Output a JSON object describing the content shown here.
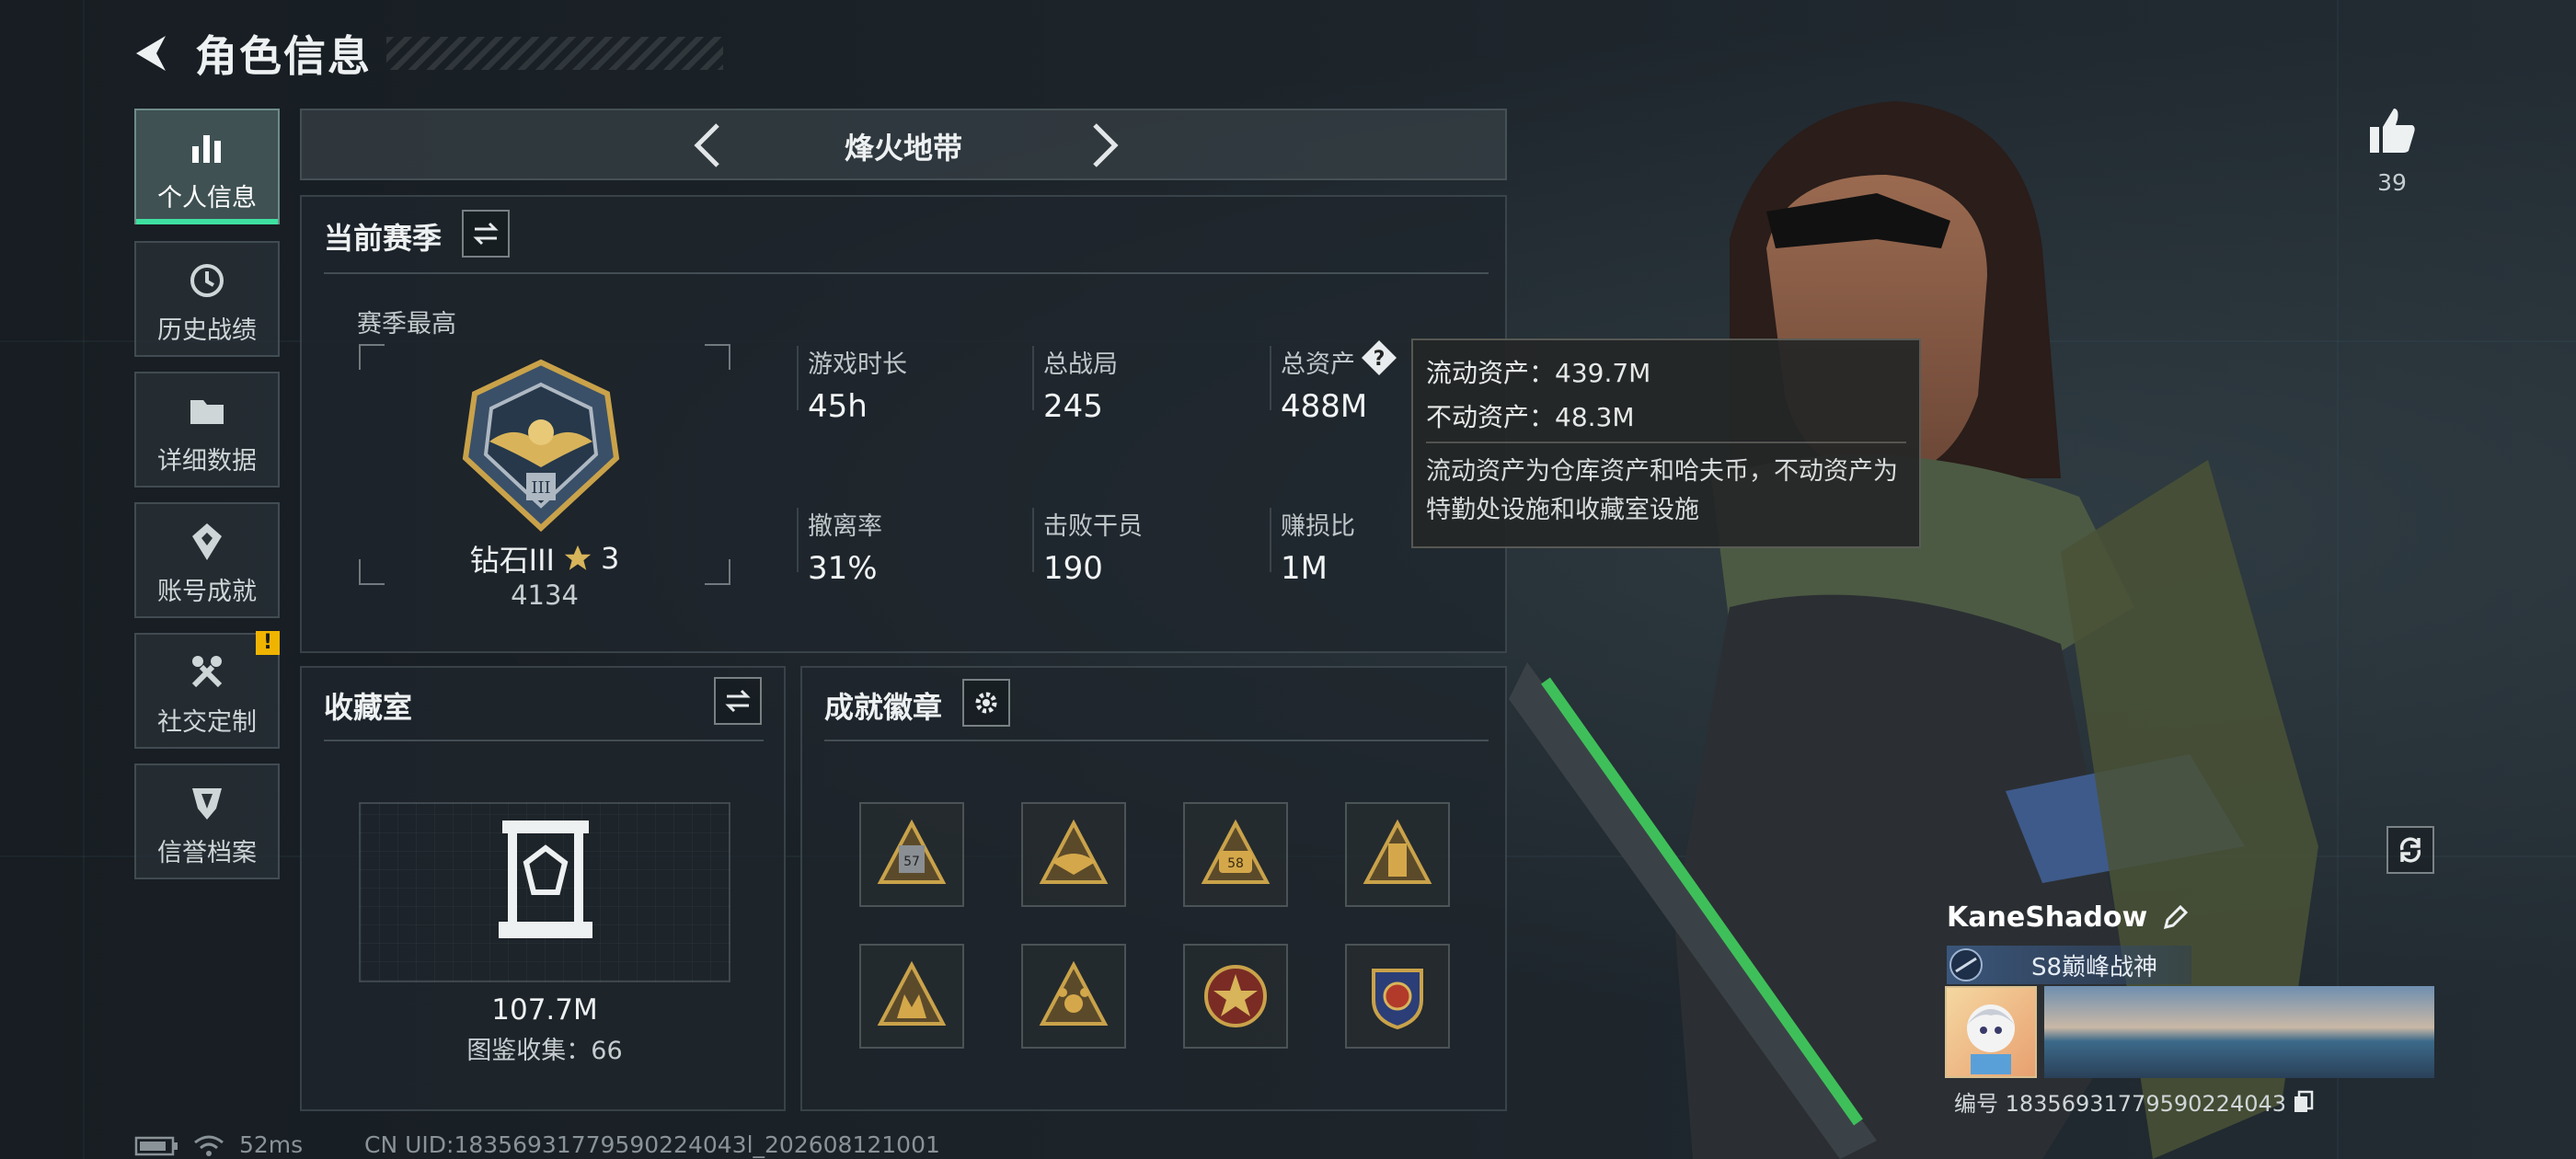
{
  "header": {
    "title": "角色信息"
  },
  "sidebar": {
    "items": [
      {
        "label": "个人信息",
        "icon": "bar-chart-icon"
      },
      {
        "label": "历史战绩",
        "icon": "history-icon"
      },
      {
        "label": "详细数据",
        "icon": "folder-icon"
      },
      {
        "label": "账号成就",
        "icon": "achievement-icon"
      },
      {
        "label": "社交定制",
        "icon": "tools-icon"
      },
      {
        "label": "信誉档案",
        "icon": "shield-icon"
      }
    ],
    "alert_badge": "!"
  },
  "mode_selector": {
    "label": "烽火地带"
  },
  "season": {
    "title": "当前赛季",
    "best_label": "赛季最高",
    "rank_name": "钻石III",
    "rank_stars": "3",
    "rank_points": "4134",
    "stats": [
      {
        "label": "游戏时长",
        "value": "45h"
      },
      {
        "label": "总战局",
        "value": "245"
      },
      {
        "label": "总资产",
        "value": "488M"
      },
      {
        "label": "撤离率",
        "value": "31%"
      },
      {
        "label": "击败干员",
        "value": "190"
      },
      {
        "label": "赚损比",
        "value": "1M"
      }
    ]
  },
  "tooltip": {
    "liquid": "流动资产：439.7M",
    "fixed": "不动资产：48.3M",
    "note": "流动资产为仓库资产和哈夫币，不动资产为特勤处设施和收藏室设施"
  },
  "collection": {
    "title": "收藏室",
    "value": "107.7M",
    "catalog": "图鉴收集：66"
  },
  "badges": {
    "title": "成就徽章",
    "items": [
      "57-badge",
      "wings-badge",
      "58-badge",
      "tower-badge",
      "squad-badge",
      "paw-badge",
      "star-wreath-badge",
      "crest-badge"
    ]
  },
  "profile": {
    "likes": "39",
    "name": "KaneShadow",
    "title_tag": "S8巅峰战神",
    "id_line": "编号 18356931779590224043"
  },
  "status": {
    "ping": "52ms",
    "uid": "CN UID:18356931779590224043l_202608121001"
  },
  "colors": {
    "accent": "#3ee0a0",
    "alert": "#f0b400",
    "gold": "#c9a24a"
  }
}
